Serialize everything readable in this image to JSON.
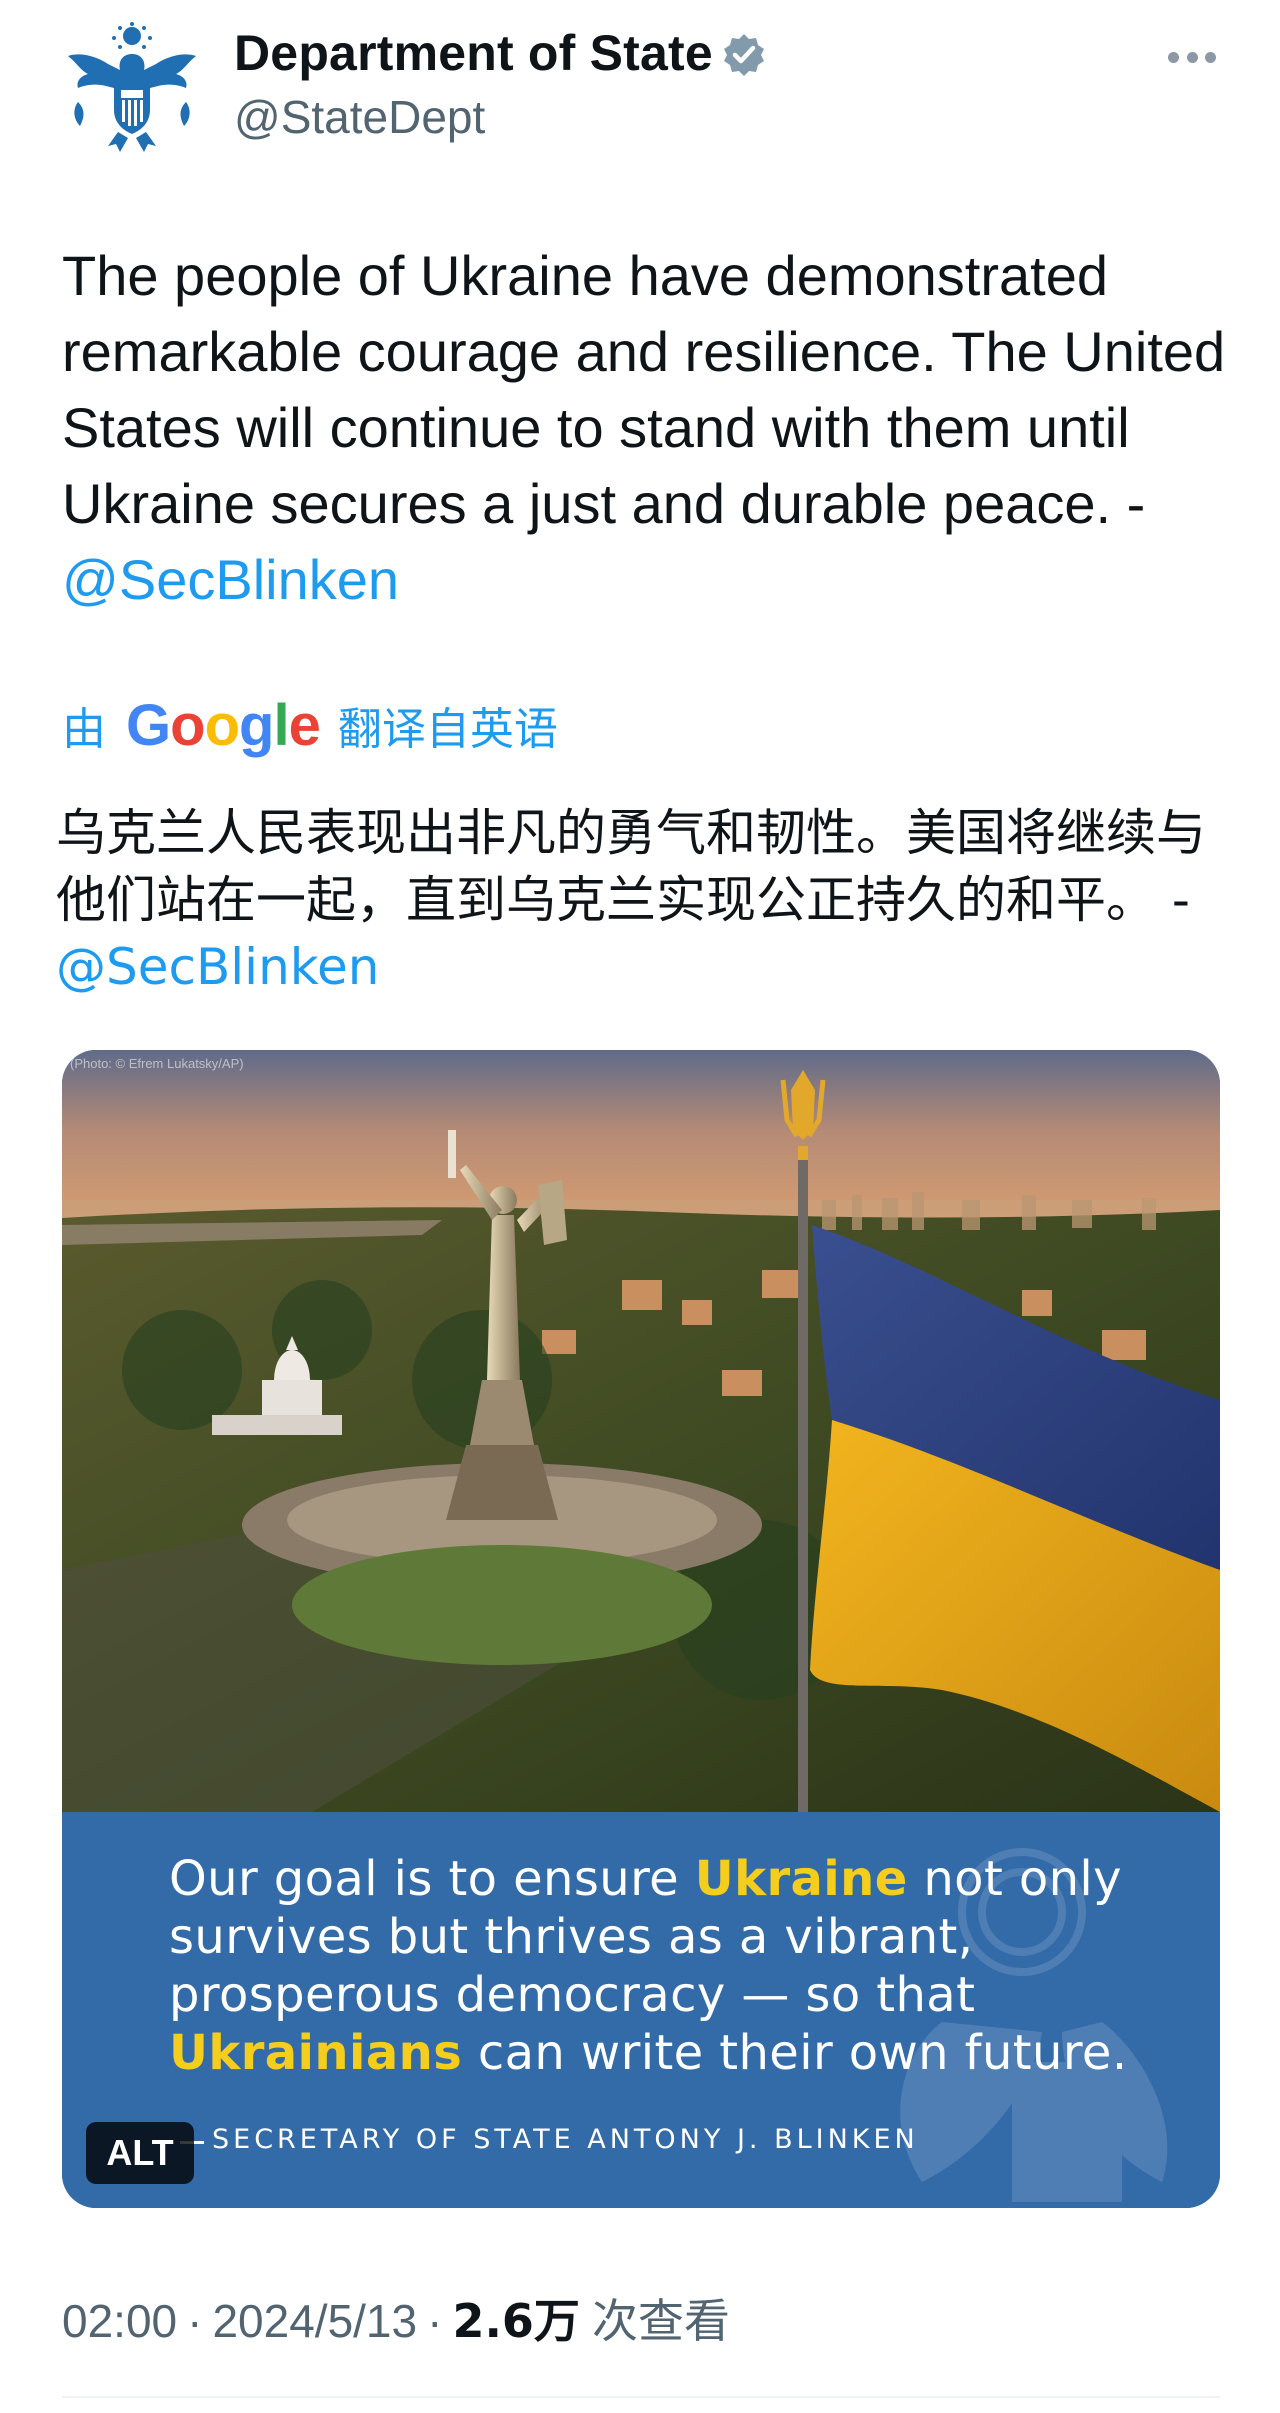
{
  "account": {
    "display_name": "Department of State",
    "handle": "@StateDept",
    "verified": true,
    "avatar_icon": "state-department-seal-icon",
    "verified_icon": "verified-badge-icon",
    "verified_color": "#829aab"
  },
  "tweet": {
    "text": "The people of Ukraine have demonstrated remarkable courage and resilience. The United States will continue to stand with them until Ukraine secures a just and durable peace. -",
    "mention": "@SecBlinken"
  },
  "translation": {
    "by_label": "由",
    "provider": "Google",
    "from_label": "翻译自英语",
    "text": "乌克兰人民表现出非凡的勇气和韧性。美国将继续与他们站在一起，直到乌克兰实现公正持久的和平。 -",
    "mention": "@SecBlinken"
  },
  "media": {
    "photo_credit": "(Photo: © Efrem Lukatsky/AP)",
    "photo_subject": "Motherland Monument and Ukrainian flag over Kyiv at sunrise",
    "quote": {
      "part1": "Our goal is to ensure ",
      "highlight1": "Ukraine",
      "part2": " not only survives but thrives as a vibrant, prosperous democracy — so that ",
      "highlight2": "Ukrainians",
      "part3": " can write their own future."
    },
    "attribution": "SECRETARY OF STATE ANTONY J. BLINKEN",
    "alt_badge": "ALT",
    "panel_color": "#336ba8",
    "highlight_color": "#f5cd1c"
  },
  "meta": {
    "time": "02:00",
    "separator": "·",
    "date": "2024/5/13",
    "views_count": "2.6万",
    "views_label": "次查看"
  },
  "colors": {
    "link": "#1d9bf0",
    "secondary_text": "#536471",
    "primary_text": "#0f1419"
  }
}
